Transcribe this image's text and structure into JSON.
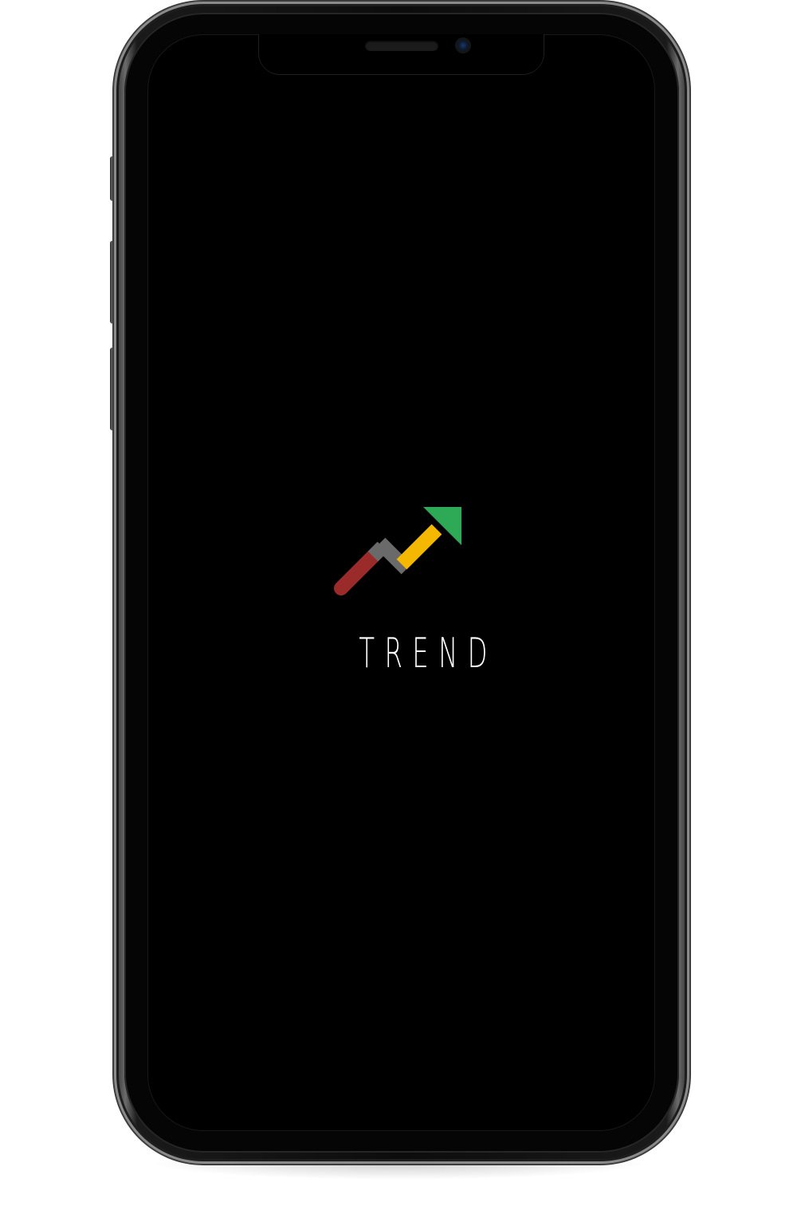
{
  "device": {
    "type": "phone-mockup",
    "screen_color": "#000000"
  },
  "splash": {
    "app_name": "TREND",
    "logo": {
      "icon": "trend-up-arrow-icon",
      "segments": [
        {
          "name": "down-segment",
          "color": "#9b2b2b"
        },
        {
          "name": "middle-segment",
          "color": "#6a6a6a"
        },
        {
          "name": "rise-segment",
          "color": "#f5b800"
        },
        {
          "name": "arrow-head",
          "color": "#2eaa57"
        }
      ]
    }
  }
}
